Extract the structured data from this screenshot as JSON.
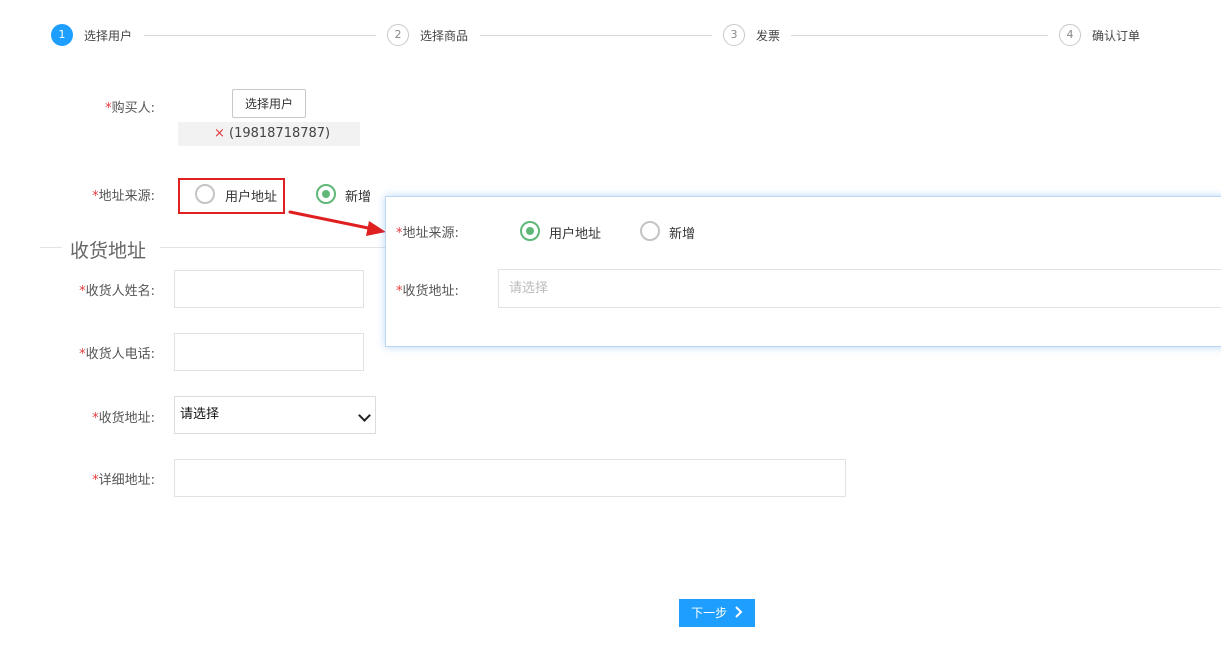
{
  "steps": [
    {
      "num": "1",
      "label": "选择用户",
      "active": true
    },
    {
      "num": "2",
      "label": "选择商品",
      "active": false
    },
    {
      "num": "3",
      "label": "发票",
      "active": false
    },
    {
      "num": "4",
      "label": "确认订单",
      "active": false
    }
  ],
  "form": {
    "required_mark": "*",
    "buyer_label": "购买人:",
    "select_user_button": "选择用户",
    "selected_user": {
      "remove": "×",
      "phone": "(19818718787)"
    },
    "address_source_label": "地址来源:",
    "address_source_options": [
      "用户地址",
      "新增"
    ],
    "address_source_selected": "新增",
    "section_title": "收货地址",
    "receiver_name_label": "收货人姓名:",
    "receiver_name_value": "",
    "receiver_phone_label": "收货人电话:",
    "receiver_phone_value": "",
    "address_label": "收货地址:",
    "address_select_value": "请选择",
    "detail_address_label": "详细地址:",
    "detail_address_value": ""
  },
  "popup": {
    "address_source_label": "地址来源:",
    "options": [
      "用户地址",
      "新增"
    ],
    "selected": "用户地址",
    "address_label": "收货地址:",
    "address_placeholder": "请选择"
  },
  "next_button": "下一步",
  "colors": {
    "primary": "#1e9fff",
    "radio_checked": "#5fb878",
    "required": "#e4393c",
    "annotation": "#e02020"
  }
}
